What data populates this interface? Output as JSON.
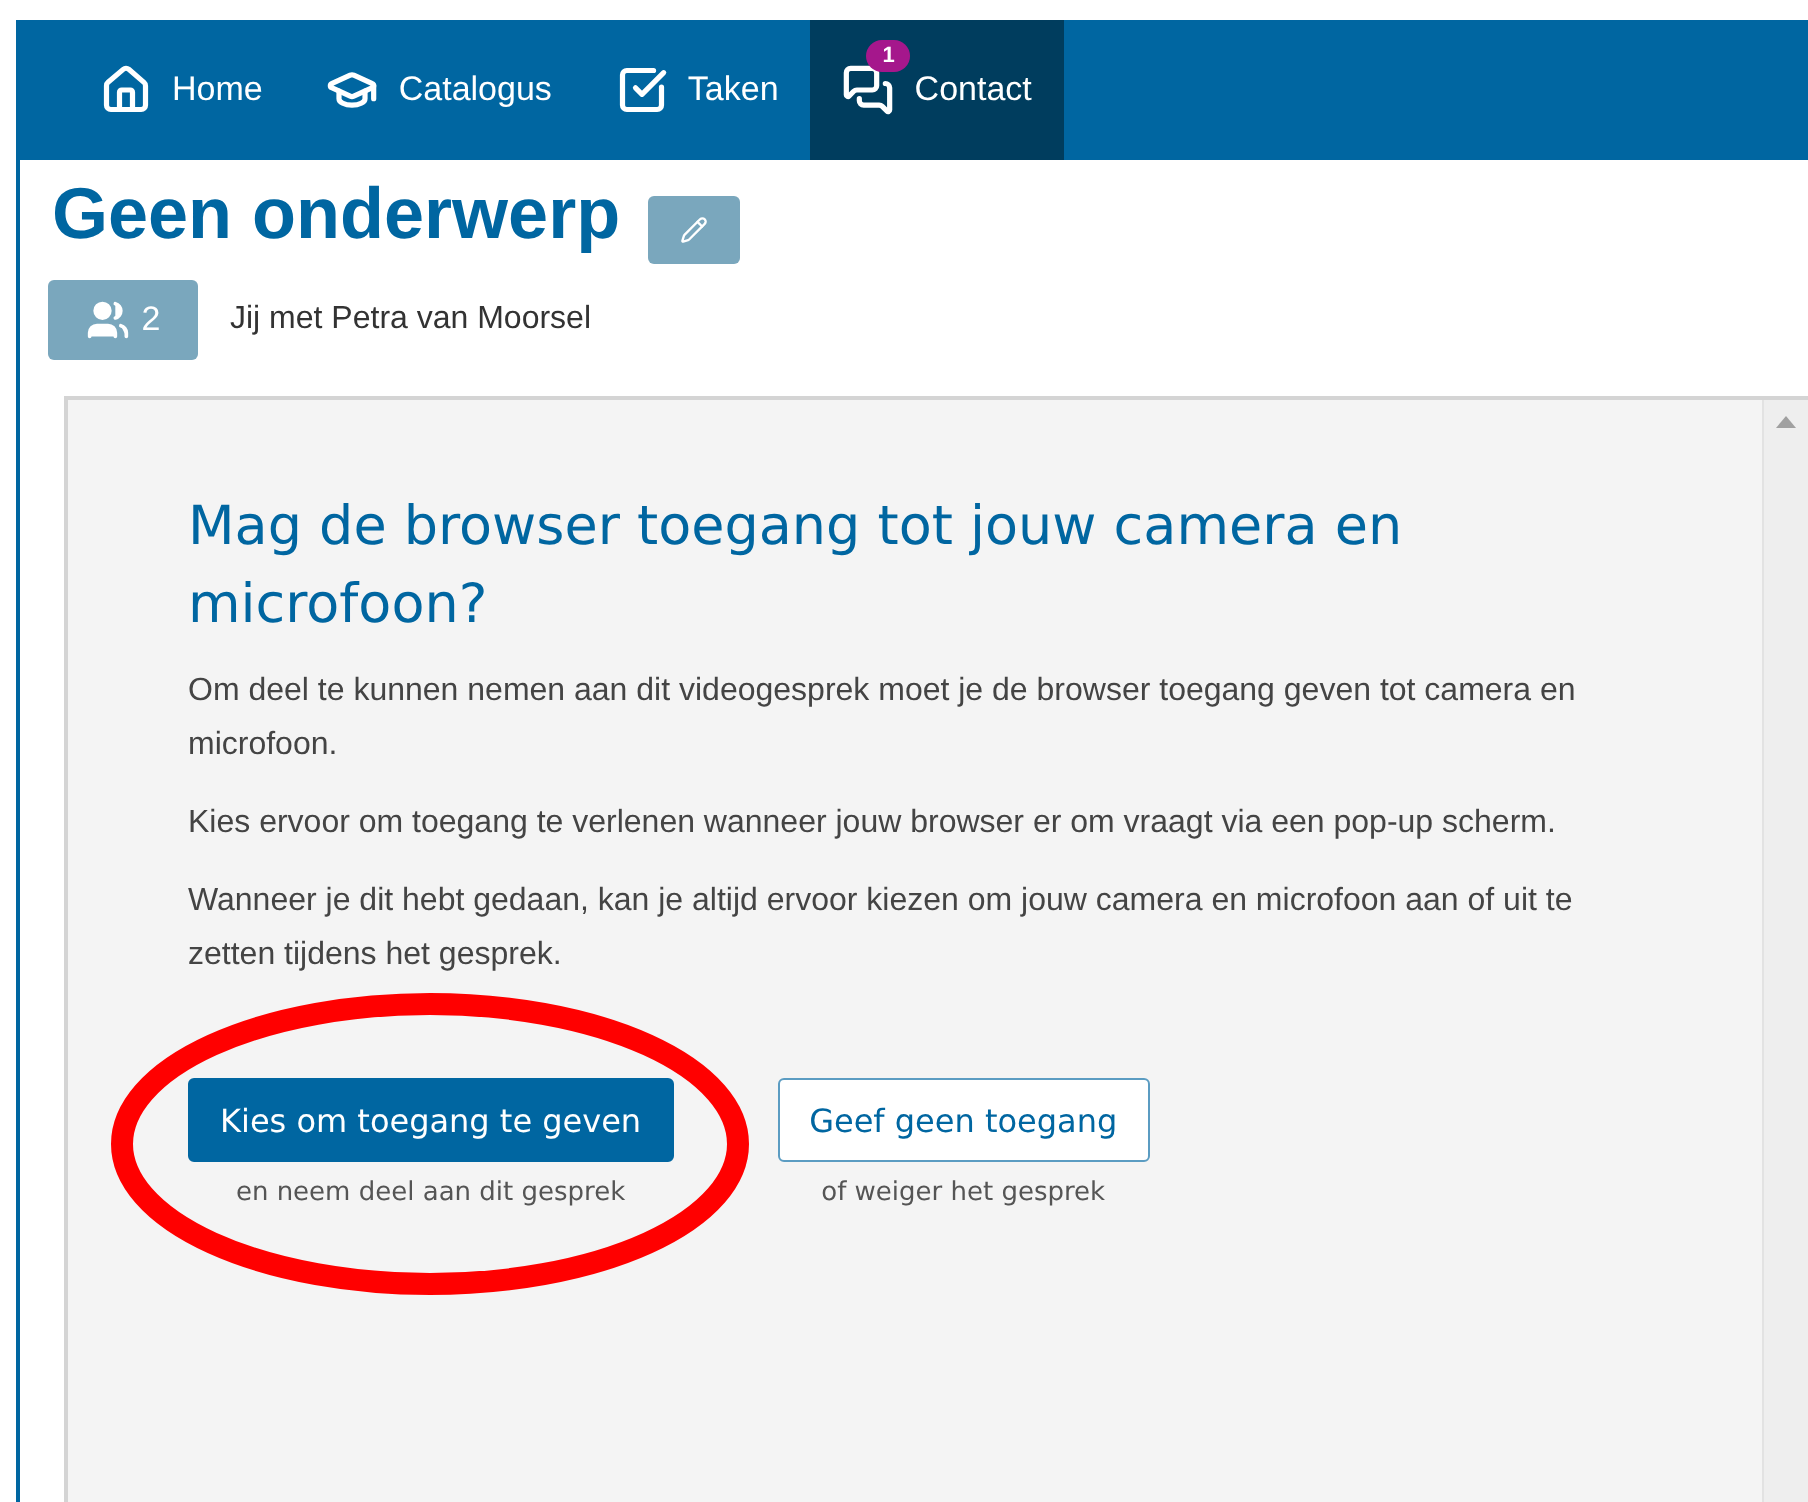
{
  "nav": {
    "items": [
      {
        "label": "Home",
        "selected": false
      },
      {
        "label": "Catalogus",
        "selected": false
      },
      {
        "label": "Taken",
        "selected": false
      },
      {
        "label": "Contact",
        "selected": true,
        "badge": "1"
      }
    ]
  },
  "page": {
    "title": "Geen onderwerp"
  },
  "participants": {
    "count": "2",
    "text": "Jij met Petra van Moorsel"
  },
  "dialog": {
    "heading": "Mag de browser toegang tot jouw camera en microfoon?",
    "paragraphs": [
      "Om deel te kunnen nemen aan dit videogesprek moet je de browser toegang geven tot camera en microfoon.",
      "Kies ervoor om toegang te verlenen wanneer jouw browser er om vraagt via een pop-up scherm.",
      "Wanneer je dit hebt gedaan, kan je altijd ervoor kiezen om jouw camera en microfoon aan of uit te zetten tijdens het gesprek."
    ],
    "actions": [
      {
        "label": "Kies om toegang te geven",
        "kind": "primary",
        "caption": "en neem deel aan dit gesprek"
      },
      {
        "label": "Geef geen toegang",
        "kind": "secondary",
        "caption": "of weiger het gesprek"
      }
    ]
  }
}
